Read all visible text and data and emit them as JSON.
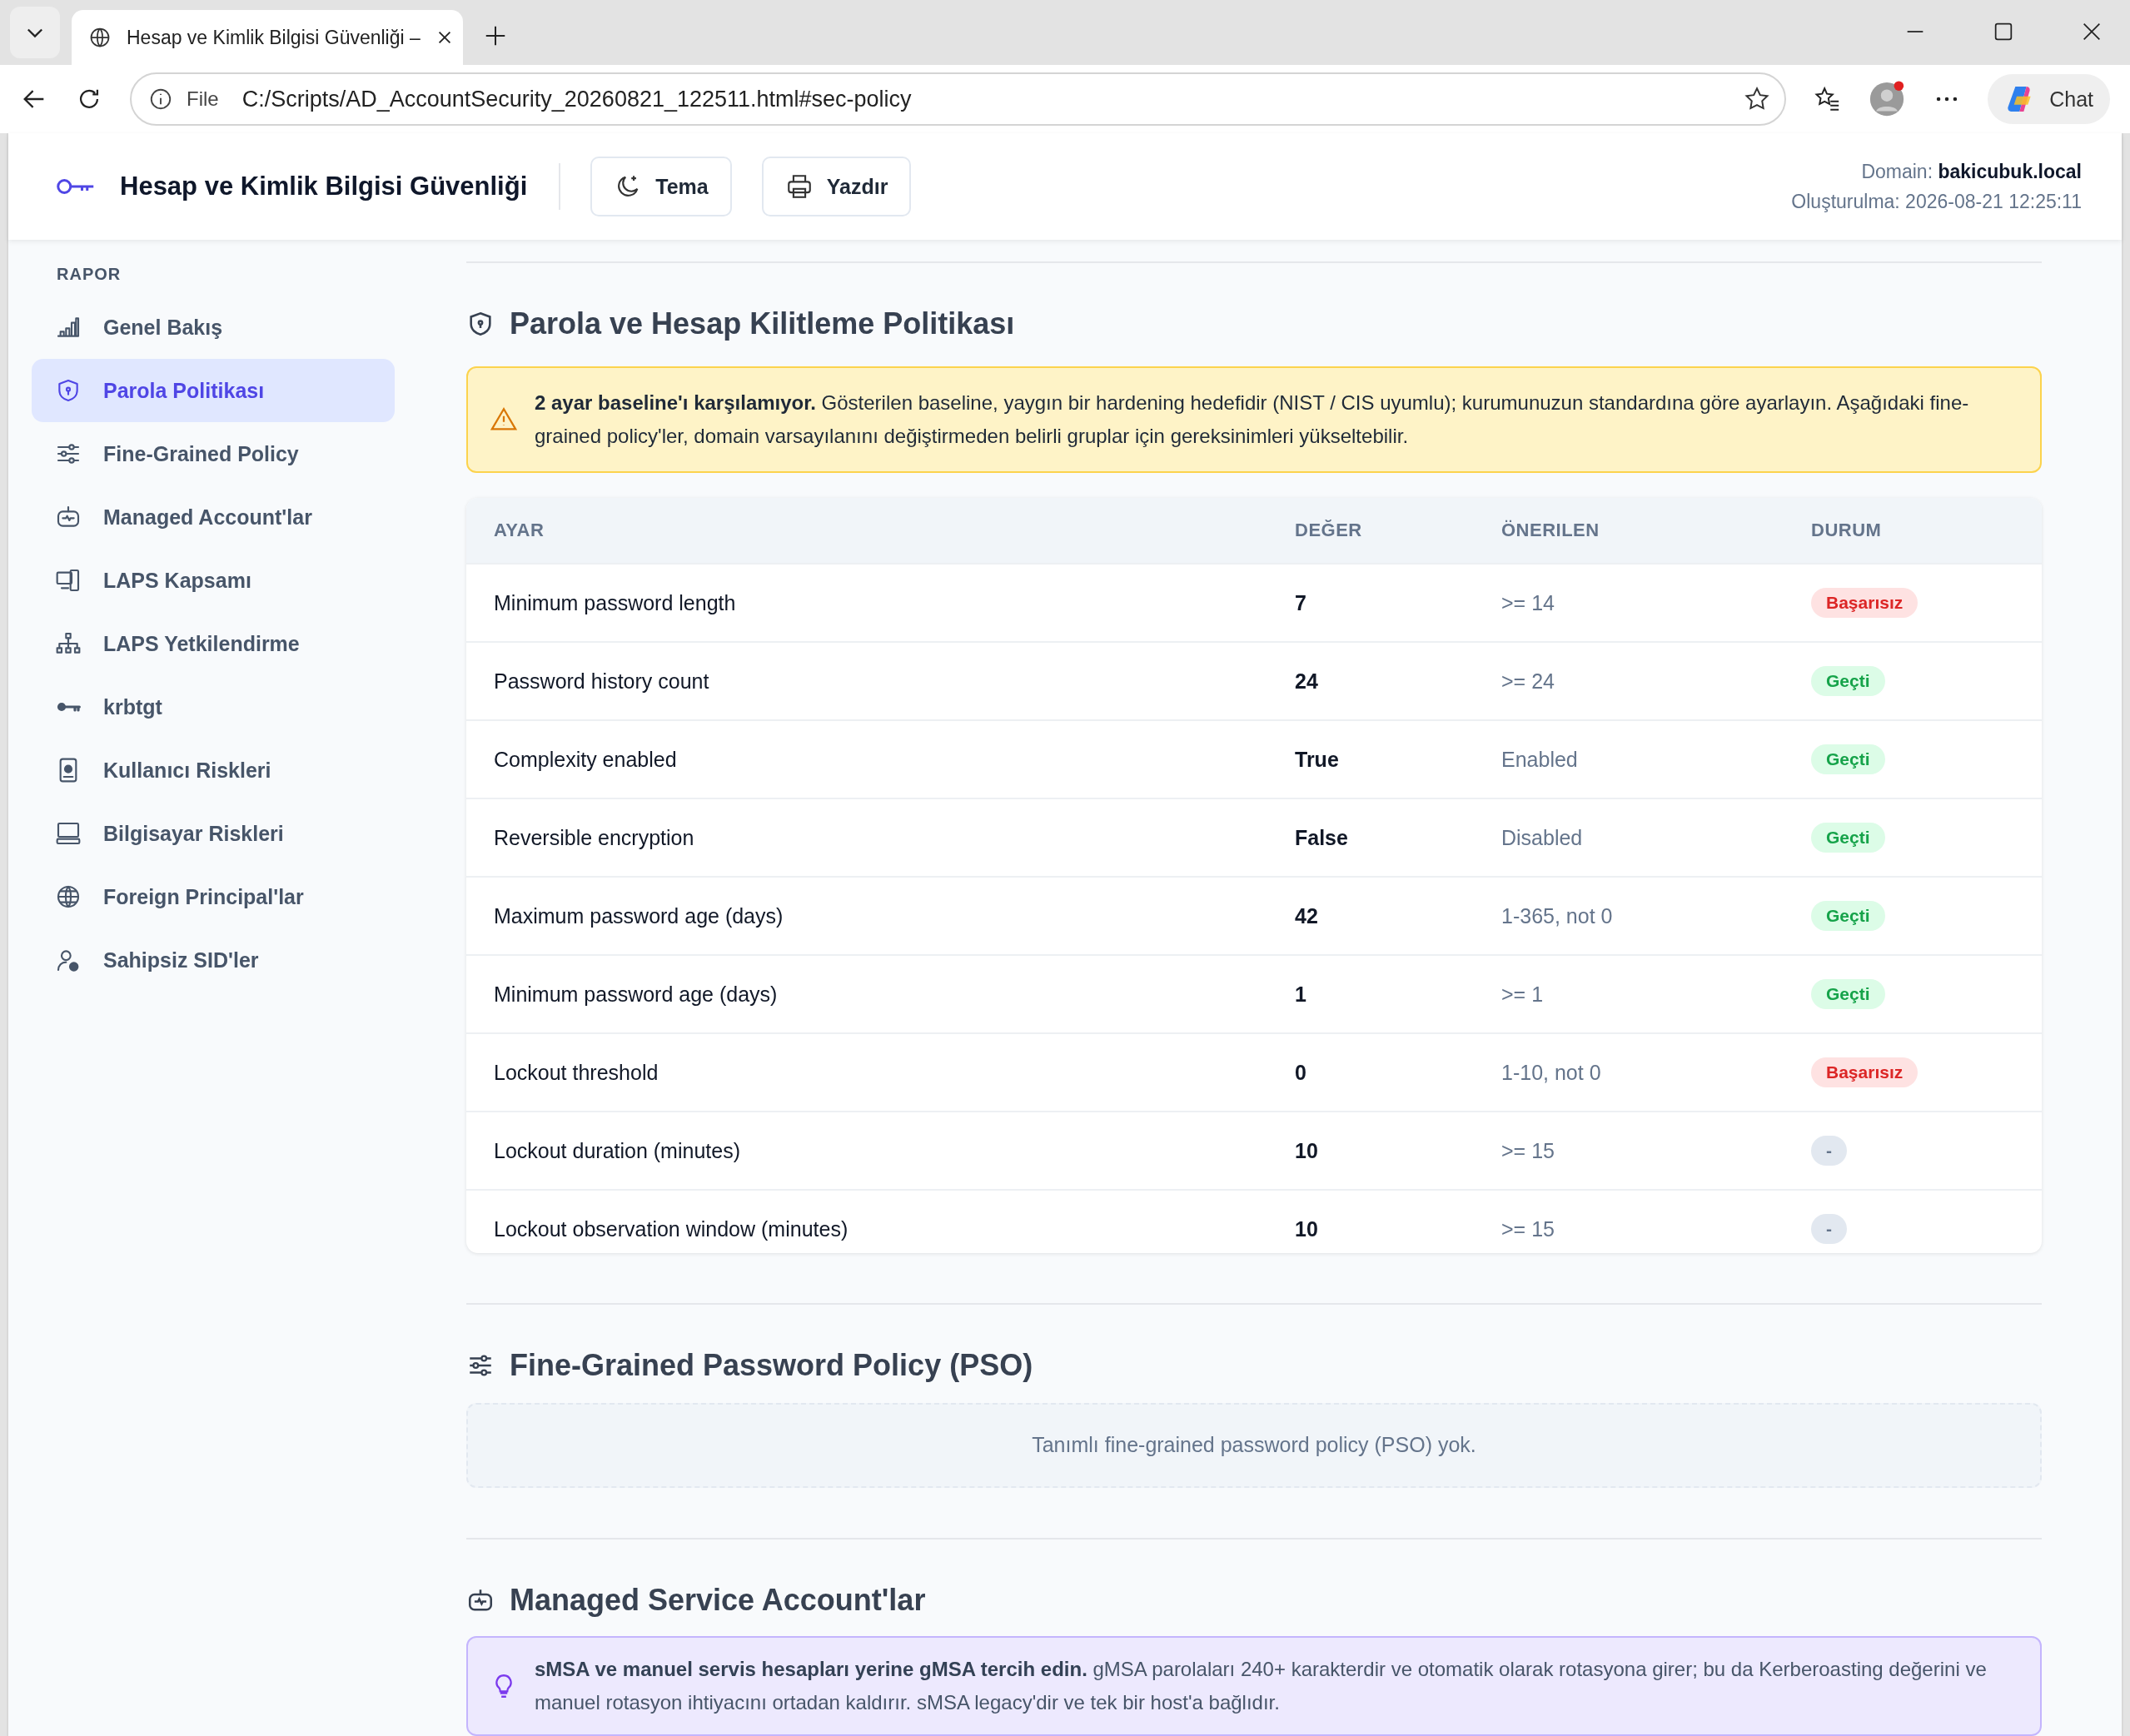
{
  "browser": {
    "tab_title": "Hesap ve Kimlik Bilgisi Güvenliği –",
    "url_scheme": "File",
    "url": "C:/Scripts/AD_AccountSecurity_20260821_122511.html#sec-policy",
    "chat_label": "Chat"
  },
  "header": {
    "title": "Hesap ve Kimlik Bilgisi Güvenliği",
    "buttons": [
      {
        "kind": "moon",
        "label": "Tema"
      },
      {
        "kind": "printer",
        "label": "Yazdır"
      }
    ],
    "domain_label": "Domain:",
    "domain_value": "bakicubuk.local",
    "created": "Oluşturulma: 2026-08-21 12:25:11"
  },
  "sidebar": {
    "heading": "RAPOR",
    "items": [
      {
        "kind": "chart",
        "label": "Genel Bakış",
        "selected": false
      },
      {
        "kind": "shield",
        "label": "Parola Politikası",
        "selected": true
      },
      {
        "kind": "sliders",
        "label": "Fine-Grained Policy",
        "selected": false
      },
      {
        "kind": "robot",
        "label": "Managed Account'lar",
        "selected": false
      },
      {
        "kind": "devices",
        "label": "LAPS Kapsamı",
        "selected": false
      },
      {
        "kind": "network",
        "label": "LAPS Yetkilendirme",
        "selected": false
      },
      {
        "kind": "key",
        "label": "krbtgt",
        "selected": false
      },
      {
        "kind": "badge",
        "label": "Kullanıcı Riskleri",
        "selected": false
      },
      {
        "kind": "computer",
        "label": "Bilgisayar Riskleri",
        "selected": false
      },
      {
        "kind": "globe",
        "label": "Foreign Principal'lar",
        "selected": false
      },
      {
        "kind": "user",
        "label": "Sahipsiz SID'ler",
        "selected": false
      }
    ]
  },
  "policy_section": {
    "title": "Parola ve Hesap Kilitleme Politikası",
    "alert": "**2 ayar baseline'ı karşılamıyor.** Gösterilen baseline, yaygın bir hardening hedefidir (NIST / CIS uyumlu); kurumunuzun standardına göre ayarlayın. Aşağıdaki fine-grained policy'ler, domain varsayılanını değiştirmeden belirli gruplar için gereksinimleri yükseltebilir.",
    "table": {
      "columns": [
        "AYAR",
        "DEĞER",
        "ÖNERILEN",
        "DURUM"
      ],
      "rows": [
        {
          "setting": "Minimum password length",
          "value": "7",
          "recommended": ">= 14",
          "status": {
            "kind": "fail",
            "label": "Başarısız"
          }
        },
        {
          "setting": "Password history count",
          "value": "24",
          "recommended": ">= 24",
          "status": {
            "kind": "pass",
            "label": "Geçti"
          }
        },
        {
          "setting": "Complexity enabled",
          "value": "True",
          "recommended": "Enabled",
          "status": {
            "kind": "pass",
            "label": "Geçti"
          }
        },
        {
          "setting": "Reversible encryption",
          "value": "False",
          "recommended": "Disabled",
          "status": {
            "kind": "pass",
            "label": "Geçti"
          }
        },
        {
          "setting": "Maximum password age (days)",
          "value": "42",
          "recommended": "1-365, not 0",
          "status": {
            "kind": "pass",
            "label": "Geçti"
          }
        },
        {
          "setting": "Minimum password age (days)",
          "value": "1",
          "recommended": ">= 1",
          "status": {
            "kind": "pass",
            "label": "Geçti"
          }
        },
        {
          "setting": "Lockout threshold",
          "value": "0",
          "recommended": "1-10, not 0",
          "status": {
            "kind": "fail",
            "label": "Başarısız"
          }
        },
        {
          "setting": "Lockout duration (minutes)",
          "value": "10",
          "recommended": ">= 15",
          "status": {
            "kind": "neutral",
            "label": "-"
          }
        },
        {
          "setting": "Lockout observation window (minutes)",
          "value": "10",
          "recommended": ">= 15",
          "status": {
            "kind": "neutral",
            "label": "-"
          }
        }
      ]
    }
  },
  "pso_section": {
    "title": "Fine-Grained Password Policy (PSO)",
    "empty_message": "Tanımlı fine-grained password policy (PSO) yok."
  },
  "msa_section": {
    "title": "Managed Service Account'lar",
    "note": "**sMSA ve manuel servis hesapları yerine gMSA tercih edin.** gMSA parolaları 240+ karakterdir ve otomatik olarak rotasyona girer; bu da Kerberoasting değerini ve manuel rotasyon ihtiyacını ortadan kaldırır. sMSA legacy'dir ve tek bir host'a bağlıdır."
  }
}
